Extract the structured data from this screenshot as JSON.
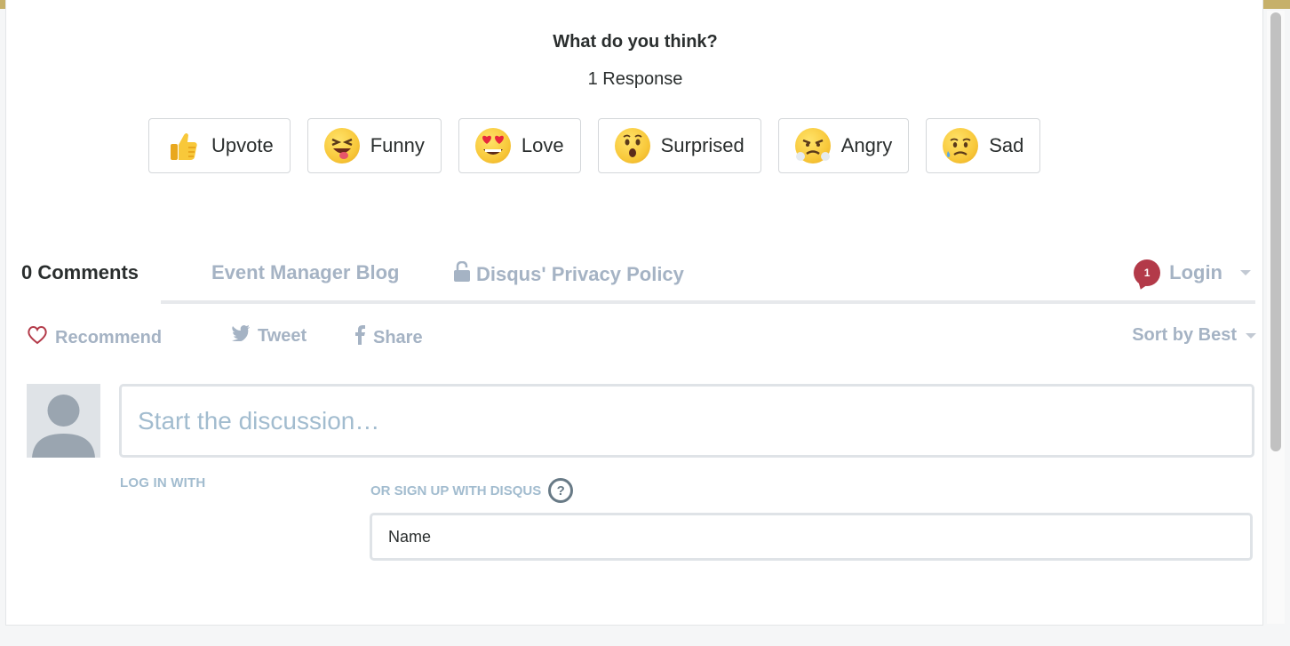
{
  "reactions_header": {
    "title": "What do you think?",
    "count": "1 Response"
  },
  "reactions": [
    {
      "label": "Upvote",
      "icon": "thumbs-up-icon"
    },
    {
      "label": "Funny",
      "icon": "funny-face-icon"
    },
    {
      "label": "Love",
      "icon": "heart-eyes-icon"
    },
    {
      "label": "Surprised",
      "icon": "surprised-face-icon"
    },
    {
      "label": "Angry",
      "icon": "angry-face-icon"
    },
    {
      "label": "Sad",
      "icon": "sad-face-icon"
    }
  ],
  "nav": {
    "comments_count": "0 Comments",
    "blog_link": "Event Manager Blog",
    "privacy_link": "Disqus' Privacy Policy",
    "login_badge": "1",
    "login_label": "Login"
  },
  "actions": {
    "recommend": "Recommend",
    "tweet": "Tweet",
    "share": "Share",
    "sort": "Sort by Best"
  },
  "composer": {
    "placeholder": "Start the discussion…",
    "login_with": "LOG IN WITH",
    "signup_with": "OR SIGN UP WITH DISQUS",
    "help_symbol": "?",
    "name_placeholder": "Name"
  },
  "colors": {
    "accent_bar": "#c6b06a",
    "link_muted": "#a5b3c4",
    "badge": "#b33a49",
    "heart": "#b33a49"
  }
}
